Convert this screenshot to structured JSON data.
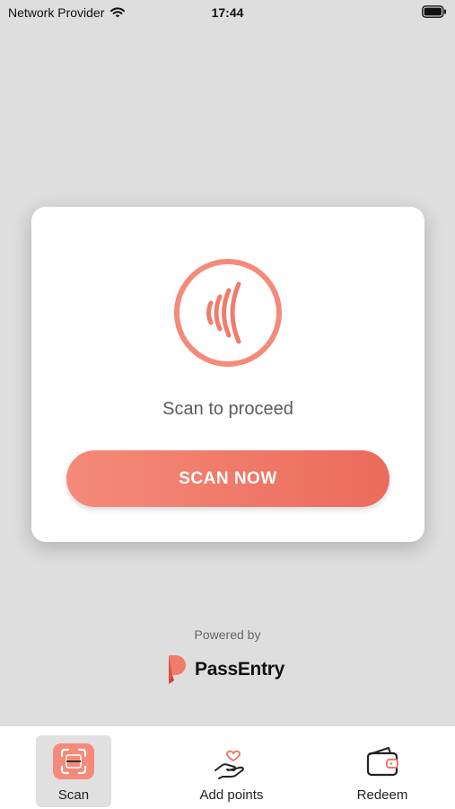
{
  "status": {
    "carrier": "Network Provider",
    "time": "17:44"
  },
  "card": {
    "icon": "nfc-contactless-icon",
    "prompt": "Scan to proceed",
    "button_label": "SCAN NOW"
  },
  "footer": {
    "powered_by": "Powered by",
    "brand": "PassEntry"
  },
  "tabs": [
    {
      "label": "Scan",
      "icon": "scan-icon",
      "active": true
    },
    {
      "label": "Add points",
      "icon": "hand-heart-icon",
      "active": false
    },
    {
      "label": "Redeem",
      "icon": "wallet-icon",
      "active": false
    }
  ],
  "colors": {
    "accent": "#f07c6c",
    "accent_dark": "#ec6b5b",
    "background": "#dedede"
  }
}
